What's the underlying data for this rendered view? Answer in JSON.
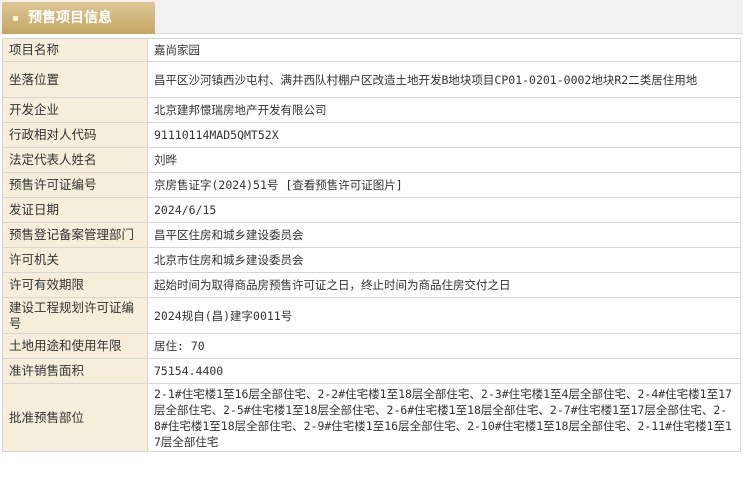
{
  "tab": {
    "title": "预售项目信息"
  },
  "rows": [
    {
      "label": "项目名称",
      "value": "嘉尚家园"
    },
    {
      "label": "坐落位置",
      "value": "昌平区沙河镇西沙屯村、满井西队村棚户区改造土地开发B地块项目CP01-0201-0002地块R2二类居住用地"
    },
    {
      "label": "开发企业",
      "value": "北京建邦憬瑞房地产开发有限公司"
    },
    {
      "label": "行政相对人代码",
      "value": "91110114MAD5QMT52X"
    },
    {
      "label": "法定代表人姓名",
      "value": "刘晔"
    },
    {
      "label": "预售许可证编号",
      "value": "京房售证字(2024)51号",
      "link": "[查看预售许可证图片]"
    },
    {
      "label": "发证日期",
      "value": "2024/6/15"
    },
    {
      "label": "预售登记备案管理部门",
      "value": "昌平区住房和城乡建设委员会"
    },
    {
      "label": "许可机关",
      "value": "北京市住房和城乡建设委员会"
    },
    {
      "label": "许可有效期限",
      "value": "起始时间为取得商品房预售许可证之日，终止时间为商品住房交付之日"
    },
    {
      "label": "建设工程规划许可证编号",
      "value": "2024规自(昌)建字0011号"
    },
    {
      "label": "土地用途和使用年限",
      "value": "居住: 70"
    },
    {
      "label": "准许销售面积",
      "value": "75154.4400"
    },
    {
      "label": "批准预售部位",
      "value": "2-1#住宅楼1至16层全部住宅、2-2#住宅楼1至18层全部住宅、2-3#住宅楼1至4层全部住宅、2-4#住宅楼1至17层全部住宅、2-5#住宅楼1至18层全部住宅、2-6#住宅楼1至18层全部住宅、2-7#住宅楼1至17层全部住宅、2-8#住宅楼1至18层全部住宅、2-9#住宅楼1至16层全部住宅、2-10#住宅楼1至18层全部住宅、2-11#住宅楼1至17层全部住宅"
    }
  ]
}
